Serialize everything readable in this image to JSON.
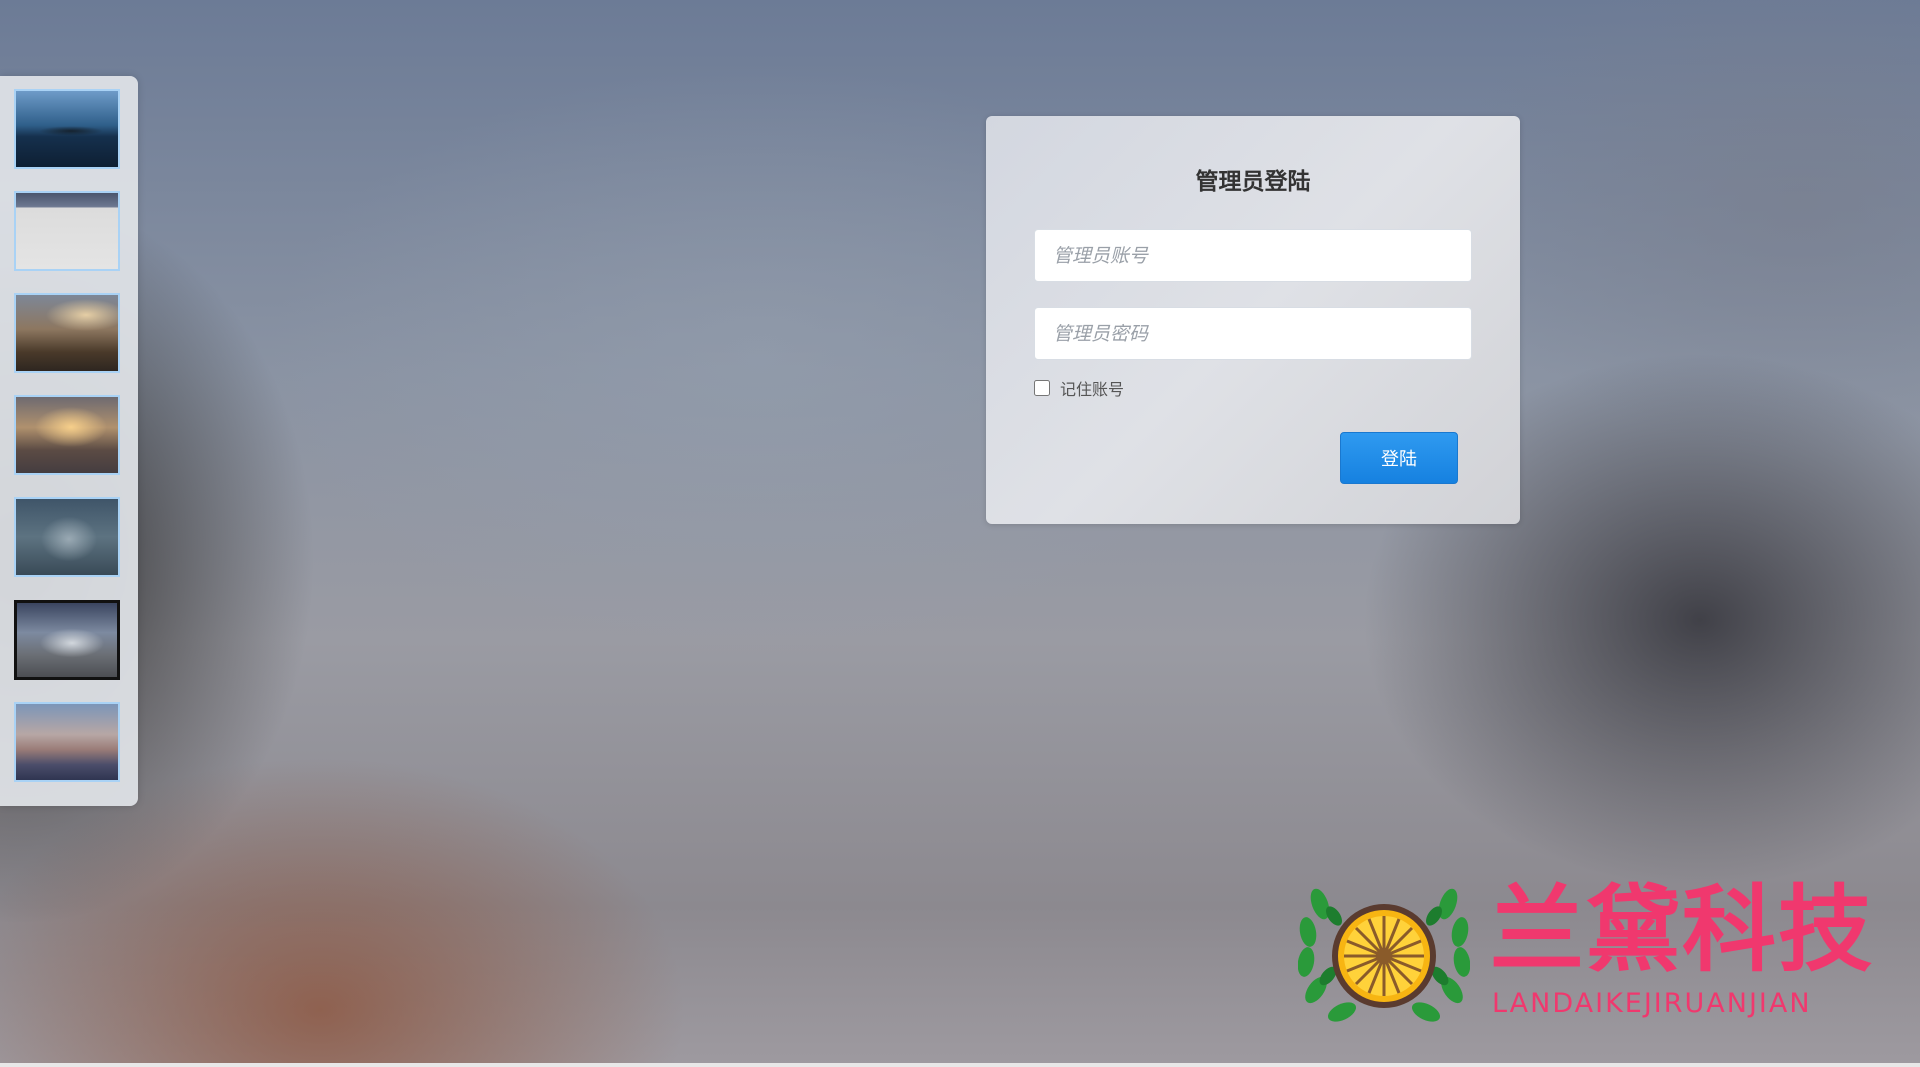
{
  "login": {
    "title": "管理员登陆",
    "account_placeholder": "管理员账号",
    "password_placeholder": "管理员密码",
    "remember_label": "记住账号",
    "submit_label": "登陆"
  },
  "thumbnails": {
    "count": 7,
    "active_index": 5
  },
  "brand": {
    "name_cn": "兰黛科技",
    "name_en": "LANDAIKEJIRUANJIAN",
    "color": "#f0386e"
  },
  "colors": {
    "button_blue": "#1681e0",
    "thumb_border": "#a9d2f5"
  },
  "icons": {
    "logo": "wreath-citrus-logo"
  }
}
